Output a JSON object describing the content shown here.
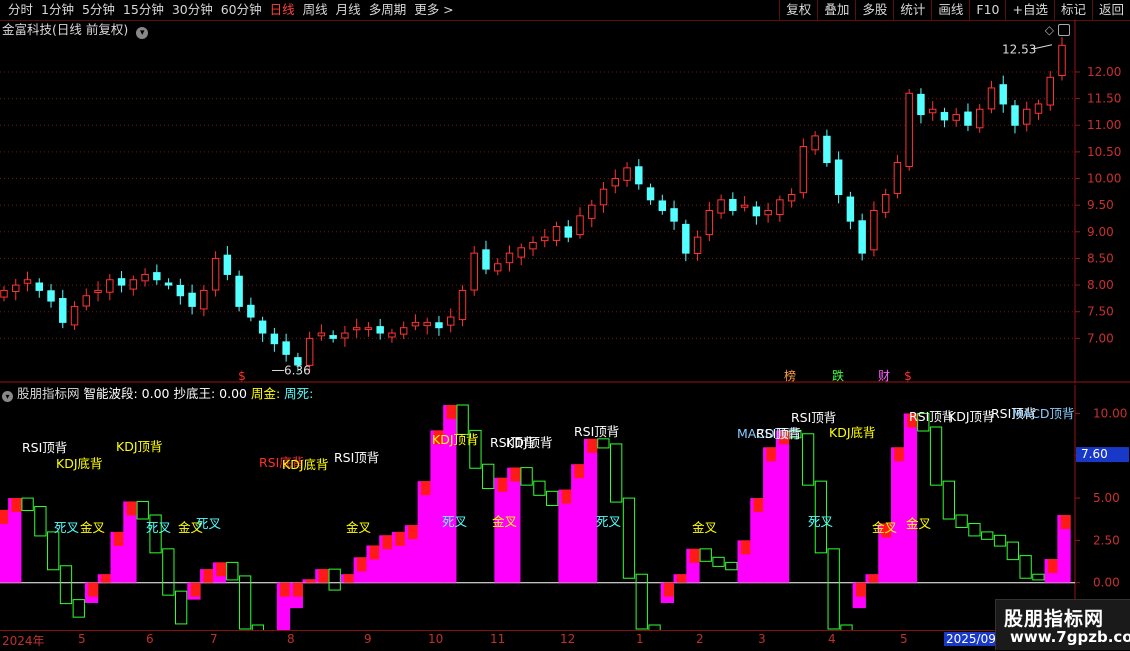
{
  "toolbar": {
    "periods": [
      "分时",
      "1分钟",
      "5分钟",
      "15分钟",
      "30分钟",
      "60分钟",
      "日线",
      "周线",
      "月线",
      "多周期",
      "更多 >"
    ],
    "active_period": "日线",
    "tools": [
      "复权",
      "叠加",
      "多股",
      "统计",
      "画线",
      "F10",
      "+自选",
      "标记",
      "返回"
    ]
  },
  "price_panel": {
    "stock_title": "金富科技(日线 前复权)",
    "high_label": "12.53",
    "low_label": "6.36",
    "event_markers": [
      {
        "text": "$",
        "color": "#ff3030"
      },
      {
        "text": "榜",
        "color": "#ffa040"
      },
      {
        "text": "跌",
        "color": "#40ff40"
      },
      {
        "text": "财",
        "color": "#ff60ff"
      },
      {
        "text": "$",
        "color": "#ff3030"
      }
    ],
    "colors": {
      "up": "#ff3333",
      "down": "#54ffff",
      "grid": "#7a1010"
    }
  },
  "indicator_panel": {
    "name": "股朋指标网",
    "fields": [
      {
        "label": "智能波段:",
        "value": "0.00",
        "color": "#ffffff"
      },
      {
        "label": "抄底王:",
        "value": "0.00",
        "color": "#ffffff"
      },
      {
        "label": "周金:",
        "value": "",
        "color": "#ffff00"
      },
      {
        "label": "周死:",
        "value": "",
        "color": "#54ffff"
      }
    ],
    "current_value": "7.60",
    "signals": [
      {
        "text": "RSI顶背",
        "color": "#ffffff"
      },
      {
        "text": "KDJ底背",
        "color": "#ffff00"
      },
      {
        "text": "KDJ顶背",
        "color": "#ffff00"
      },
      {
        "text": "RSI底背",
        "color": "#ff3030"
      },
      {
        "text": "KDJ底背",
        "color": "#ffff00"
      },
      {
        "text": "RSI顶背",
        "color": "#ffffff"
      },
      {
        "text": "KDJ顶背",
        "color": "#ffff00"
      },
      {
        "text": "RSI顶背",
        "color": "#ffffff"
      },
      {
        "text": "KDJ顶背",
        "color": "#ffffff"
      },
      {
        "text": "RSI顶背",
        "color": "#ffffff"
      },
      {
        "text": "MACD顶背",
        "color": "#88ccff"
      },
      {
        "text": "RSI顶背",
        "color": "#ffffff"
      },
      {
        "text": "RSI顶背",
        "color": "#ffffff"
      },
      {
        "text": "KDJ底背",
        "color": "#ffff00"
      },
      {
        "text": "RSI顶背",
        "color": "#ffffff"
      },
      {
        "text": "KDJ顶背",
        "color": "#ffffff"
      },
      {
        "text": "RSI顶背",
        "color": "#ffffff"
      },
      {
        "text": "MACD顶背",
        "color": "#88ccff"
      }
    ],
    "cross_labels": [
      {
        "text": "死叉",
        "color": "#54ffff"
      },
      {
        "text": "金叉",
        "color": "#ffff00"
      },
      {
        "text": "死叉",
        "color": "#54ffff"
      },
      {
        "text": "金叉",
        "color": "#ffff00"
      },
      {
        "text": "死叉",
        "color": "#54ffff"
      },
      {
        "text": "金叉",
        "color": "#ffff00"
      },
      {
        "text": "金叉",
        "color": "#ffff00"
      },
      {
        "text": "死叉",
        "color": "#54ffff"
      },
      {
        "text": "金叉",
        "color": "#ffff00"
      },
      {
        "text": "死叉",
        "color": "#54ffff"
      },
      {
        "text": "金叉",
        "color": "#ffff00"
      },
      {
        "text": "死叉",
        "color": "#54ffff"
      },
      {
        "text": "金叉",
        "color": "#ffff00"
      }
    ]
  },
  "chart_data": [
    {
      "type": "candlestick",
      "title": "金富科技(日线 前复权)",
      "ylim": [
        6.5,
        12.6
      ],
      "yticks": [
        "12.00",
        "11.50",
        "11.00",
        "10.50",
        "10.00",
        "9.50",
        "9.00",
        "8.50",
        "8.00",
        "7.50",
        "7.00"
      ],
      "high_marker": 12.53,
      "low_marker": 6.36,
      "close_series": [
        7.9,
        8.0,
        8.1,
        7.9,
        7.7,
        7.3,
        7.6,
        7.8,
        7.9,
        8.1,
        8.0,
        8.1,
        8.2,
        8.1,
        8.0,
        7.8,
        7.6,
        7.9,
        8.5,
        8.2,
        7.6,
        7.4,
        7.1,
        6.9,
        6.7,
        6.5,
        7.0,
        7.1,
        7.0,
        7.1,
        7.2,
        7.2,
        7.1,
        7.1,
        7.2,
        7.3,
        7.3,
        7.2,
        7.4,
        7.9,
        8.6,
        8.3,
        8.4,
        8.6,
        8.7,
        8.8,
        8.9,
        9.1,
        8.9,
        9.3,
        9.5,
        9.8,
        10.0,
        10.2,
        9.9,
        9.6,
        9.4,
        9.2,
        8.6,
        8.9,
        9.4,
        9.6,
        9.4,
        9.5,
        9.3,
        9.4,
        9.6,
        9.7,
        10.6,
        10.8,
        10.3,
        9.7,
        9.2,
        8.6,
        9.4,
        9.7,
        10.3,
        11.6,
        11.2,
        11.3,
        11.1,
        11.2,
        11.0,
        11.3,
        11.7,
        11.4,
        11.0,
        11.3,
        11.4,
        11.9,
        12.5
      ],
      "date_ticks": [
        "2024年",
        "5",
        "6",
        "7",
        "8",
        "9",
        "10",
        "11",
        "12",
        "1",
        "2",
        "3",
        "4",
        "5",
        "2025/09"
      ]
    },
    {
      "type": "bar",
      "title": "股朋指标网",
      "ylim": [
        -2.5,
        10.5
      ],
      "yticks": [
        "10.00",
        "7.50",
        "5.00",
        "2.50",
        "0.00"
      ],
      "current_value": 7.6,
      "series": [
        {
          "values": [
            4.3,
            5.0,
            4.5,
            3.0,
            1.0,
            -1.0,
            -1.8,
            -1.2,
            0.5,
            3.0,
            4.8,
            4.0,
            2.0,
            -0.5,
            -2.2,
            -1.0,
            0.8,
            1.2,
            0.4,
            -2.5,
            -3.5,
            -3.8,
            -3.0,
            -1.5,
            0.2,
            0.8,
            -0.2,
            0.5,
            1.5,
            2.2,
            2.8,
            3.0,
            3.4,
            6.0,
            9.0,
            10.5,
            9.0,
            7.0,
            5.8,
            6.2,
            6.8,
            6.0,
            5.4,
            4.8,
            5.5,
            7.0,
            8.5,
            8.2,
            5.0,
            0.5,
            -2.5,
            -2.8,
            -1.2,
            0.5,
            2.0,
            1.5,
            1.2,
            1.0,
            2.5,
            5.0,
            8.0,
            9.0,
            8.8,
            6.0,
            2.0,
            -2.5,
            -2.8,
            -1.5,
            0.5,
            3.5,
            8.0,
            10.0,
            9.2,
            6.0,
            4.0,
            3.5,
            3.0,
            2.8,
            2.4,
            1.6,
            0.5,
            0.4,
            1.4,
            4.0
          ]
        }
      ]
    }
  ]
}
